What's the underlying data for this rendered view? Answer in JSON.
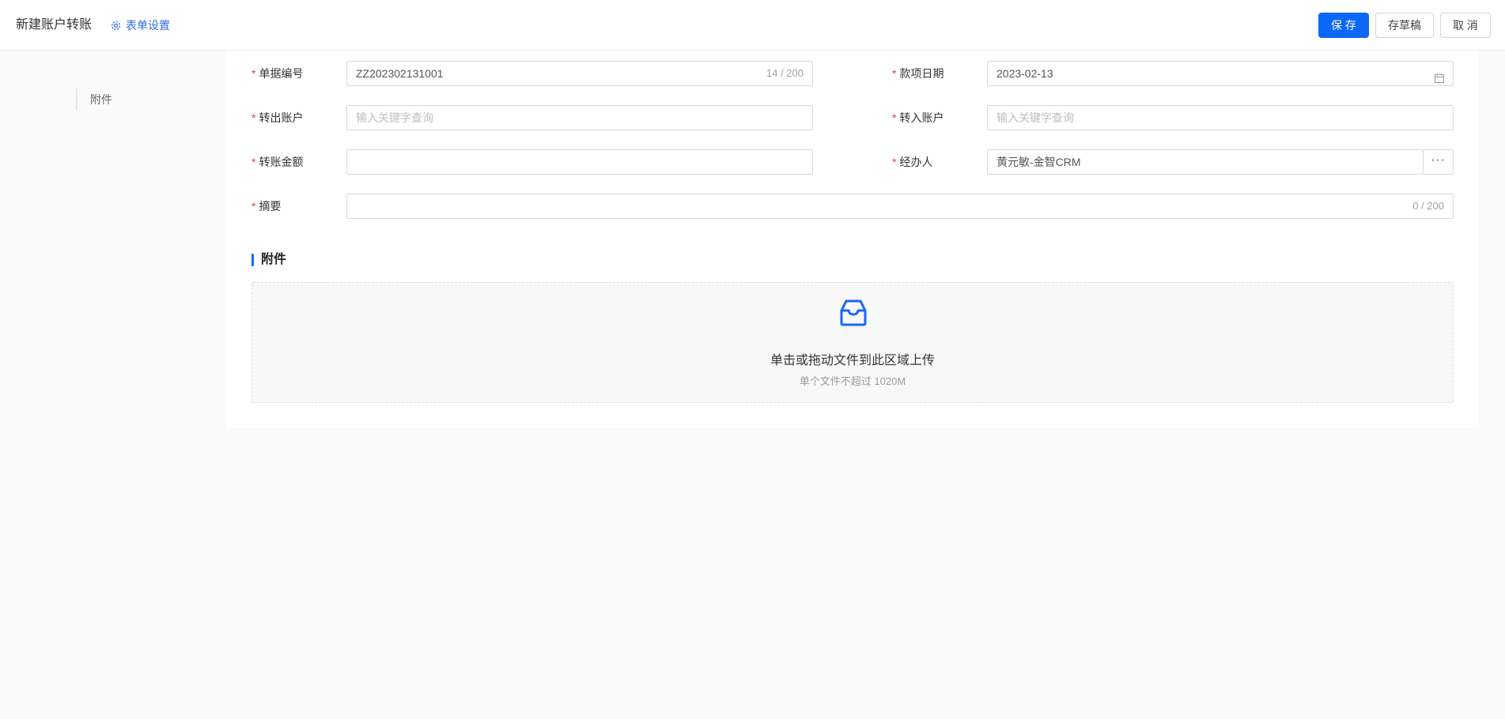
{
  "header": {
    "title": "新建账户转账",
    "form_settings_label": "表单设置",
    "save_label": "保 存",
    "draft_label": "存草稿",
    "cancel_label": "取 消"
  },
  "side_nav": {
    "items": [
      {
        "label": "附件"
      }
    ]
  },
  "form": {
    "doc_no": {
      "label": "单据编号",
      "value": "ZZ202302131001",
      "counter": "14 / 200"
    },
    "date": {
      "label": "款项日期",
      "value": "2023-02-13"
    },
    "out_account": {
      "label": "转出账户",
      "placeholder": "输入关键字查询"
    },
    "in_account": {
      "label": "转入账户",
      "placeholder": "输入关键字查询"
    },
    "amount": {
      "label": "转账金额",
      "value": ""
    },
    "handler": {
      "label": "经办人",
      "value": "黄元敏-金智CRM",
      "more": "···"
    },
    "summary": {
      "label": "摘要",
      "value": "",
      "counter": "0 / 200"
    }
  },
  "attachments": {
    "title": "附件",
    "upload_text": "单击或拖动文件到此区域上传",
    "upload_hint": "单个文件不超过 1020M"
  },
  "colors": {
    "primary": "#0b67f7",
    "link": "#2f6bdf",
    "required": "#e53935",
    "section_bar": "#1769f5"
  },
  "icons": [
    "gear-icon",
    "calendar-icon",
    "inbox-icon",
    "more-icon"
  ]
}
